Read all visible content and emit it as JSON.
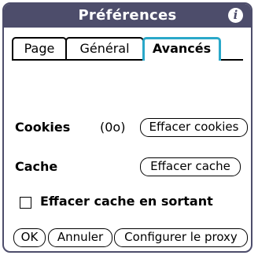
{
  "window": {
    "title": "Préférences",
    "info_icon": "i"
  },
  "tabs": [
    {
      "label": "Page",
      "selected": false
    },
    {
      "label": "Général",
      "selected": false
    },
    {
      "label": "Avancés",
      "selected": true
    }
  ],
  "cookies": {
    "label": "Cookies",
    "count": "(0o)",
    "clear_button": "Effacer cookies"
  },
  "cache": {
    "label": "Cache",
    "clear_button": "Effacer cache"
  },
  "clear_on_exit": {
    "label": "Effacer cache en sortant",
    "checked": false
  },
  "footer": {
    "ok": "OK",
    "cancel": "Annuler",
    "proxy": "Configurer le proxy"
  },
  "colors": {
    "titlebar": "#4d4d6b",
    "selected_tab_border": "#2aa8c9"
  }
}
